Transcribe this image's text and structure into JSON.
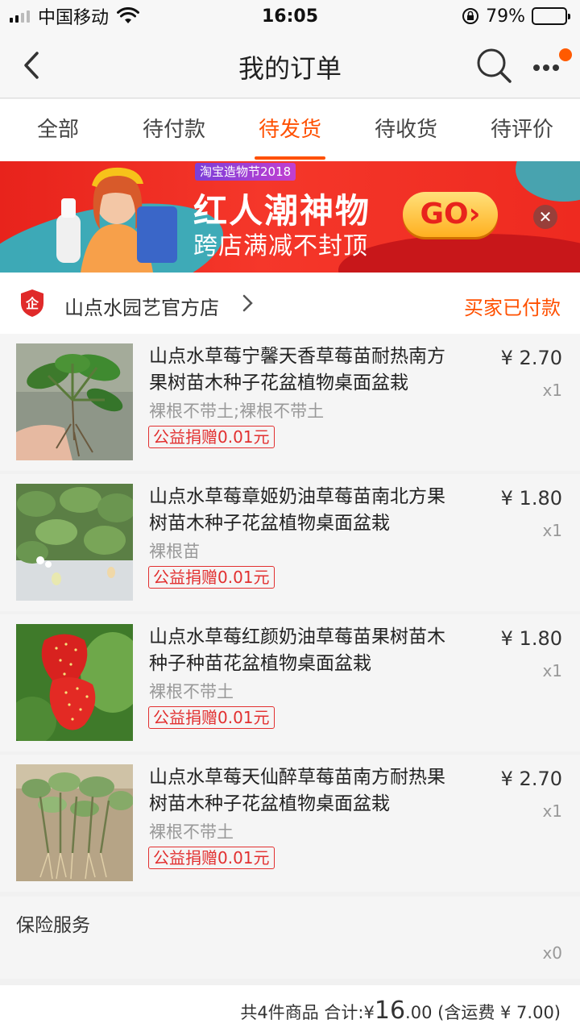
{
  "status_bar": {
    "carrier": "中国移动",
    "time": "16:05",
    "battery_percent": "79%",
    "battery_level": 0.79
  },
  "nav": {
    "title": "我的订单"
  },
  "tabs": [
    {
      "label": "全部",
      "active": false
    },
    {
      "label": "待付款",
      "active": false
    },
    {
      "label": "待发货",
      "active": true
    },
    {
      "label": "待收货",
      "active": false
    },
    {
      "label": "待评价",
      "active": false
    }
  ],
  "banner": {
    "tag": "淘宝造物节2018",
    "title": "红人潮神物",
    "subtitle": "跨店满减不封顶",
    "go_label": "GO",
    "close_label": "✕"
  },
  "shop": {
    "name": "山点水园艺官方店",
    "status": "买家已付款"
  },
  "items": [
    {
      "title": "山点水草莓宁馨天香草莓苗耐热南方果树苗木种子花盆植物桌面盆栽",
      "spec": "裸根不带土;裸根不带土",
      "charity": "公益捐赠0.01元",
      "price": "¥ 2.70",
      "qty": "x1",
      "image_type": "plant-root"
    },
    {
      "title": "山点水草莓章姬奶油草莓苗南北方果树苗木种子花盆植物桌面盆栽",
      "spec": "裸根苗",
      "charity": "公益捐赠0.01元",
      "price": "¥ 1.80",
      "qty": "x1",
      "image_type": "plant-field"
    },
    {
      "title": "山点水草莓红颜奶油草莓苗果树苗木种子种苗花盆植物桌面盆栽",
      "spec": "裸根不带土",
      "charity": "公益捐赠0.01元",
      "price": "¥ 1.80",
      "qty": "x1",
      "image_type": "strawberry"
    },
    {
      "title": "山点水草莓天仙醉草莓苗南方耐热果树苗木种子花盆植物桌面盆栽",
      "spec": "裸根不带土",
      "charity": "公益捐赠0.01元",
      "price": "¥ 2.70",
      "qty": "x1",
      "image_type": "plant-bundle"
    }
  ],
  "insurance": {
    "label": "保险服务",
    "qty": "x0"
  },
  "total": {
    "count_text": "共4件商品",
    "sum_label": "合计:",
    "currency": "¥",
    "amount_int": "16",
    "amount_dec": ".00",
    "shipping": "(含运费 ¥ 7.00)"
  },
  "colors": {
    "accent": "#ff5000",
    "charity": "#e23030",
    "banner_red": "#e8231c"
  }
}
